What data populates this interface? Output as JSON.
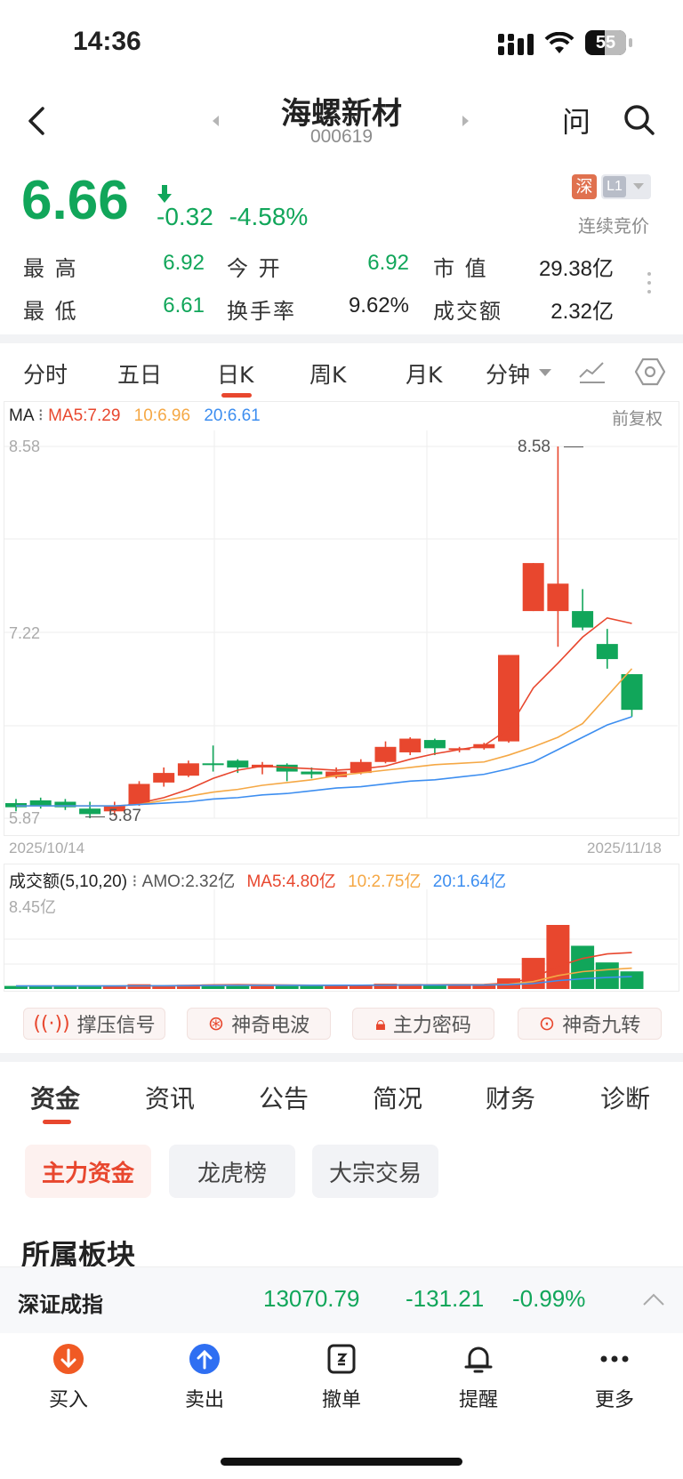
{
  "status": {
    "time": "14:36",
    "battery": "55"
  },
  "header": {
    "name": "海螺新材",
    "code": "000619",
    "ask": "问"
  },
  "quote": {
    "price": "6.66",
    "change": "-0.32",
    "change_pct": "-4.58%",
    "exchange_badge": "深",
    "level_badge": "L1",
    "trade_status": "连续竞价",
    "high_label": "最  高",
    "high": "6.92",
    "open_label": "今  开",
    "open": "6.92",
    "mktcap_label": "市  值",
    "mktcap": "29.38亿",
    "low_label": "最  低",
    "low": "6.61",
    "turnover_label": "换手率",
    "turnover": "9.62%",
    "amount_label": "成交额",
    "amount": "2.32亿"
  },
  "chart_tabs": [
    "分时",
    "五日",
    "日K",
    "周K",
    "月K",
    "分钟"
  ],
  "ma_legend": {
    "label": "MA",
    "ma5": "MA5:7.29",
    "ma10": "10:6.96",
    "ma20": "20:6.61",
    "adjust": "前复权"
  },
  "price_axis": {
    "top": "8.58",
    "mid": "7.22",
    "bottom": "5.87",
    "max_mark": "8.58",
    "min_mark": "5.87"
  },
  "date_axis": {
    "start": "2025/10/14",
    "end": "2025/11/18"
  },
  "volume_legend": {
    "label": "成交额(5,10,20)",
    "amo": "AMO:2.32亿",
    "ma5": "MA5:4.80亿",
    "ma10": "10:2.75亿",
    "ma20": "20:1.64亿",
    "top": "8.45亿"
  },
  "indicators": [
    "撑压信号",
    "神奇电波",
    "主力密码",
    "神奇九转"
  ],
  "section_tabs": [
    "资金",
    "资讯",
    "公告",
    "简况",
    "财务",
    "诊断"
  ],
  "fund_pills": [
    "主力资金",
    "龙虎榜",
    "大宗交易"
  ],
  "sector_title": "所属板块",
  "index_bar": {
    "name": "深证成指",
    "value": "13070.79",
    "change": "-131.21",
    "pct": "-0.99%"
  },
  "tabbar": [
    "买入",
    "卖出",
    "撤单",
    "提醒",
    "更多"
  ],
  "colors": {
    "up": "#e8472e",
    "down": "#11a65a",
    "ma5": "#e8472e",
    "ma10": "#f5a845",
    "ma20": "#3d8ef0"
  },
  "chart_data": {
    "type": "candlestick",
    "price_range": [
      5.87,
      8.58
    ],
    "candles": [
      {
        "o": 5.98,
        "c": 5.95,
        "h": 6.01,
        "l": 5.92
      },
      {
        "o": 6.0,
        "c": 5.96,
        "h": 6.02,
        "l": 5.94
      },
      {
        "o": 5.99,
        "c": 5.95,
        "h": 6.01,
        "l": 5.93
      },
      {
        "o": 5.94,
        "c": 5.9,
        "h": 5.99,
        "l": 5.87
      },
      {
        "o": 5.92,
        "c": 5.96,
        "h": 5.99,
        "l": 5.89
      },
      {
        "o": 5.97,
        "c": 6.12,
        "h": 6.14,
        "l": 5.96
      },
      {
        "o": 6.13,
        "c": 6.2,
        "h": 6.24,
        "l": 6.1
      },
      {
        "o": 6.18,
        "c": 6.27,
        "h": 6.29,
        "l": 6.17
      },
      {
        "o": 6.27,
        "c": 6.26,
        "h": 6.4,
        "l": 6.21
      },
      {
        "o": 6.29,
        "c": 6.24,
        "h": 6.3,
        "l": 6.2
      },
      {
        "o": 6.24,
        "c": 6.26,
        "h": 6.28,
        "l": 6.19
      },
      {
        "o": 6.26,
        "c": 6.21,
        "h": 6.27,
        "l": 6.14
      },
      {
        "o": 6.21,
        "c": 6.19,
        "h": 6.24,
        "l": 6.16
      },
      {
        "o": 6.17,
        "c": 6.21,
        "h": 6.24,
        "l": 6.16
      },
      {
        "o": 6.2,
        "c": 6.28,
        "h": 6.3,
        "l": 6.19
      },
      {
        "o": 6.28,
        "c": 6.39,
        "h": 6.43,
        "l": 6.27
      },
      {
        "o": 6.35,
        "c": 6.45,
        "h": 6.46,
        "l": 6.33
      },
      {
        "o": 6.44,
        "c": 6.38,
        "h": 6.45,
        "l": 6.33
      },
      {
        "o": 6.37,
        "c": 6.38,
        "h": 6.39,
        "l": 6.35
      },
      {
        "o": 6.38,
        "c": 6.41,
        "h": 6.42,
        "l": 6.37
      },
      {
        "o": 6.43,
        "c": 7.06,
        "h": 7.06,
        "l": 6.42
      },
      {
        "o": 7.38,
        "c": 7.73,
        "h": 7.73,
        "l": 7.38
      },
      {
        "o": 7.38,
        "c": 7.58,
        "h": 8.58,
        "l": 7.12
      },
      {
        "o": 7.38,
        "c": 7.26,
        "h": 7.54,
        "l": 7.24
      },
      {
        "o": 7.14,
        "c": 7.03,
        "h": 7.25,
        "l": 6.96
      },
      {
        "o": 6.92,
        "c": 6.66,
        "h": 6.92,
        "l": 6.61
      }
    ],
    "ma5": [
      null,
      null,
      null,
      null,
      5.95,
      5.98,
      6.02,
      6.08,
      6.16,
      6.22,
      6.25,
      6.24,
      6.23,
      6.22,
      6.23,
      6.25,
      6.3,
      6.34,
      6.37,
      6.4,
      6.52,
      6.82,
      7.0,
      7.19,
      7.33,
      7.29
    ],
    "ma10": [
      5.96,
      5.96,
      5.96,
      5.96,
      5.96,
      5.97,
      6.0,
      6.03,
      6.06,
      6.08,
      6.11,
      6.13,
      6.15,
      6.18,
      6.2,
      6.22,
      6.24,
      6.26,
      6.27,
      6.28,
      6.33,
      6.39,
      6.46,
      6.56,
      6.76,
      6.96
    ],
    "ma20": [
      5.96,
      5.96,
      5.96,
      5.96,
      5.96,
      5.97,
      5.98,
      5.99,
      6.01,
      6.02,
      6.04,
      6.05,
      6.07,
      6.09,
      6.1,
      6.12,
      6.14,
      6.15,
      6.17,
      6.19,
      6.23,
      6.28,
      6.37,
      6.46,
      6.55,
      6.61
    ],
    "volume_range": [
      0,
      8.45
    ],
    "volume": [
      0.4,
      0.42,
      0.38,
      0.34,
      0.36,
      0.62,
      0.5,
      0.55,
      0.6,
      0.52,
      0.48,
      0.45,
      0.44,
      0.42,
      0.48,
      0.7,
      0.66,
      0.55,
      0.5,
      0.52,
      1.4,
      4.1,
      8.45,
      5.7,
      3.5,
      2.32
    ],
    "vol_ma5": [
      null,
      null,
      null,
      null,
      0.38,
      0.42,
      0.44,
      0.47,
      0.53,
      0.56,
      0.53,
      0.52,
      0.5,
      0.46,
      0.45,
      0.52,
      0.55,
      0.56,
      0.58,
      0.59,
      0.77,
      1.45,
      3.0,
      4.03,
      4.63,
      4.8
    ],
    "vol_ma10": [
      0.4,
      0.4,
      0.4,
      0.4,
      0.4,
      0.41,
      0.42,
      0.43,
      0.45,
      0.47,
      0.48,
      0.48,
      0.48,
      0.49,
      0.5,
      0.52,
      0.53,
      0.53,
      0.54,
      0.55,
      0.62,
      0.98,
      1.77,
      2.29,
      2.54,
      2.75
    ],
    "vol_ma20": [
      0.4,
      0.4,
      0.4,
      0.4,
      0.4,
      0.41,
      0.42,
      0.43,
      0.45,
      0.47,
      0.48,
      0.48,
      0.48,
      0.49,
      0.5,
      0.51,
      0.52,
      0.52,
      0.52,
      0.52,
      0.56,
      0.72,
      1.1,
      1.35,
      1.52,
      1.64
    ]
  }
}
